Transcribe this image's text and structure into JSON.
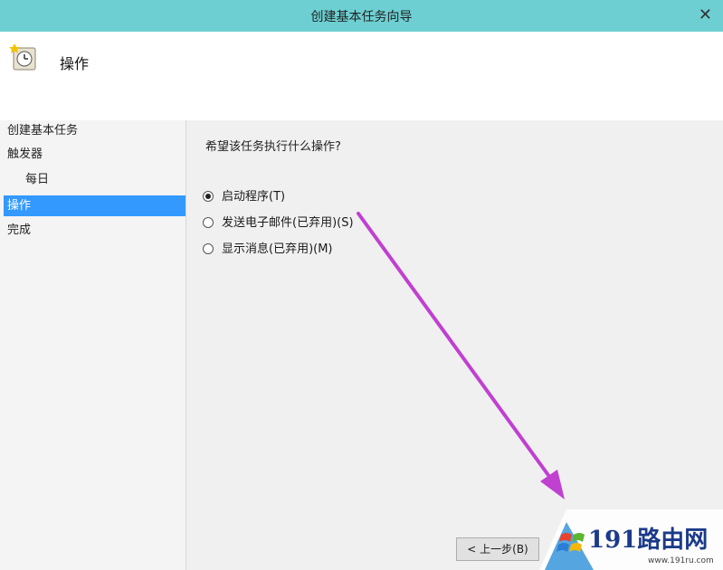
{
  "window": {
    "title": "创建基本任务向导",
    "close_glyph": "✕",
    "titlebar_color": "#6dcfd2"
  },
  "header": {
    "icon": "task-clock-icon",
    "heading": "操作"
  },
  "nav": {
    "items": [
      {
        "label": "创建基本任务",
        "active": false
      },
      {
        "label": "触发器",
        "active": false
      },
      {
        "label": "每日",
        "active": false
      },
      {
        "label": "操作",
        "active": true
      },
      {
        "label": "完成",
        "active": false
      }
    ],
    "active_color": "#3399ff"
  },
  "main": {
    "prompt": "希望该任务执行什么操作?",
    "options": [
      {
        "label": "启动程序(T)",
        "checked": true
      },
      {
        "label": "发送电子邮件(已弃用)(S)",
        "checked": false
      },
      {
        "label": "显示消息(已弃用)(M)",
        "checked": false
      }
    ]
  },
  "footer": {
    "back_label": "< 上一步(B)"
  },
  "annotation": {
    "arrow_color": "#c040d0"
  },
  "watermark": {
    "brand": "191路由网",
    "url": "www.191ru.com"
  }
}
